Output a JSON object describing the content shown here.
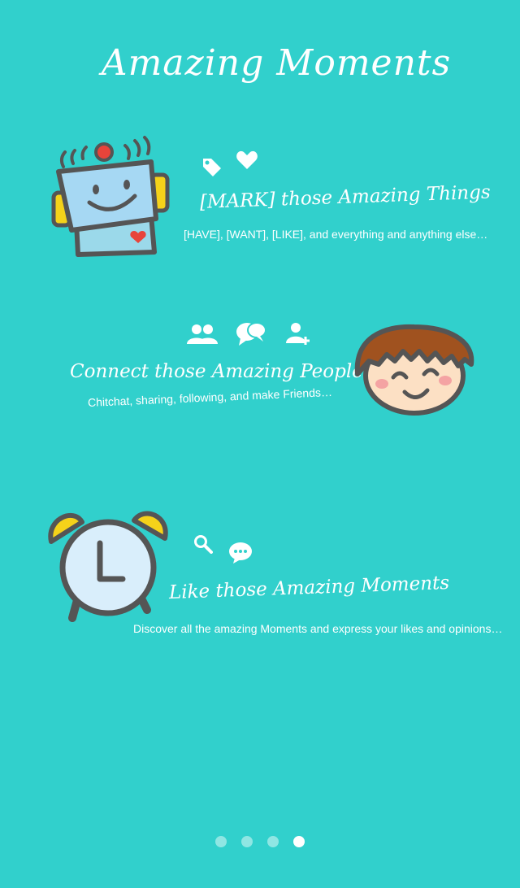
{
  "title": "Amazing Moments",
  "sections": [
    {
      "heading": "[MARK] those Amazing Things",
      "subtitle": "[HAVE], [WANT], [LIKE], and everything and anything else…",
      "icons": [
        "tag-icon",
        "heart-icon"
      ],
      "illustration": "robot-illustration"
    },
    {
      "heading": "Connect those Amazing People",
      "subtitle": "Chitchat, sharing, following, and make Friends…",
      "icons": [
        "people-icon",
        "chat-bubbles-icon",
        "add-user-icon"
      ],
      "illustration": "smiling-boy-illustration"
    },
    {
      "heading": "Like those Amazing Moments",
      "subtitle": "Discover all the amazing Moments and express your likes and opinions…",
      "icons": [
        "search-icon",
        "speech-bubble-icon"
      ],
      "illustration": "alarm-clock-illustration"
    }
  ],
  "pagination": {
    "total": 4,
    "active_index": 3
  },
  "colors": {
    "background": "#31d0cc",
    "accent_yellow": "#f5d21a",
    "accent_red": "#e8443a",
    "outline": "#555555"
  }
}
